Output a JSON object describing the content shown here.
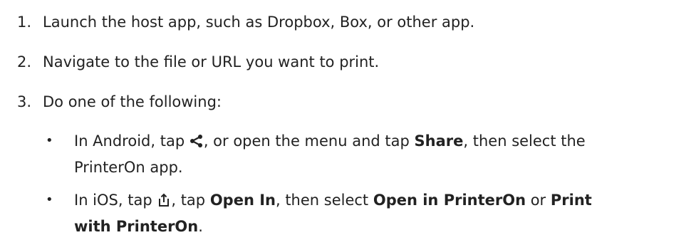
{
  "steps": [
    {
      "number": "1.",
      "text": "Launch the host app, such as Dropbox, Box, or other app."
    },
    {
      "number": "2.",
      "text": "Navigate to the file or URL you want to print."
    },
    {
      "number": "3.",
      "text": "Do one of the following:"
    }
  ],
  "bullets": {
    "android": {
      "marker": "•",
      "prefix": "In Android, tap ",
      "icon": "share-icon",
      "middle": ", or open the menu and tap ",
      "bold_share": "Share",
      "suffix": ", then select the",
      "line2": "PrinterOn app."
    },
    "ios": {
      "marker": "•",
      "prefix": "In iOS, tap ",
      "icon": "ios-share-icon",
      "middle1": ", tap ",
      "bold_open_in": "Open In",
      "middle2": ", then select ",
      "bold_open_in_printeron": "Open in PrinterOn",
      "middle3": " or ",
      "bold_print_line1": "Print",
      "bold_print_line2": "with PrinterOn",
      "suffix": "."
    }
  }
}
